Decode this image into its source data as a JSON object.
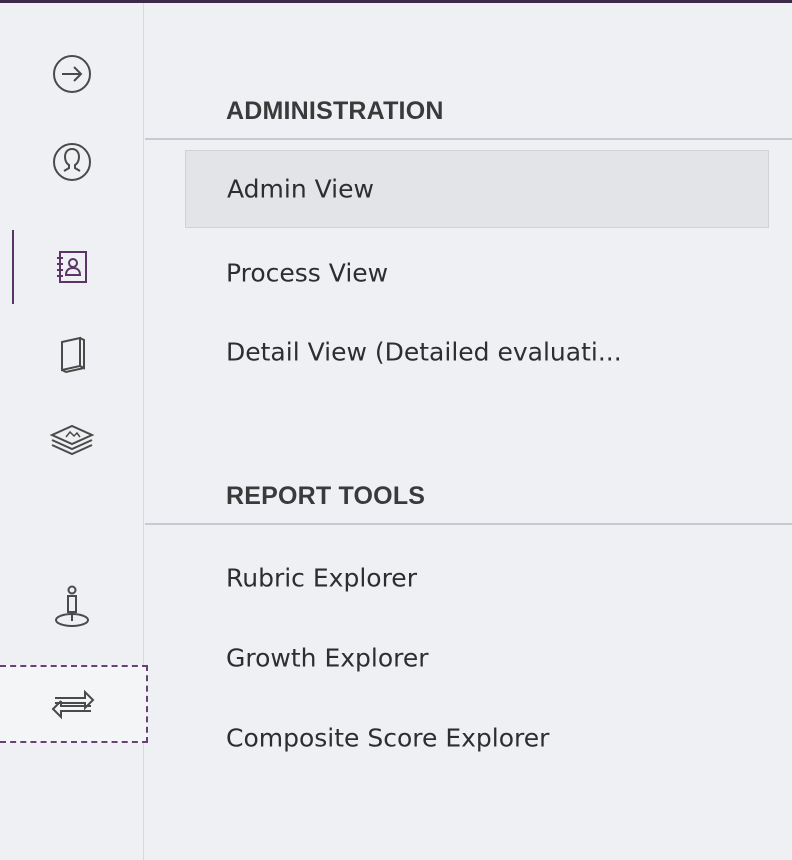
{
  "colors": {
    "accent": "#5b3566",
    "background": "#eef0f3",
    "selected_bg": "#e2e4e7",
    "text": "#2e2e2e"
  },
  "rail": {
    "icons": [
      {
        "name": "arrow-right-circle-icon",
        "active": false
      },
      {
        "name": "user-circle-icon",
        "active": false
      },
      {
        "name": "contacts-book-icon",
        "active": true
      },
      {
        "name": "book-icon",
        "active": false
      },
      {
        "name": "layers-icon",
        "active": false
      },
      {
        "name": "person-pin-icon",
        "active": false
      },
      {
        "name": "swap-arrows-icon",
        "active": false,
        "focused": true
      }
    ]
  },
  "panel": {
    "sections": [
      {
        "title": "ADMINISTRATION",
        "items": [
          {
            "label": "Admin View",
            "selected": true
          },
          {
            "label": "Process View",
            "selected": false
          },
          {
            "label": "Detail View (Detailed evaluati...",
            "selected": false
          }
        ]
      },
      {
        "title": "REPORT TOOLS",
        "items": [
          {
            "label": "Rubric Explorer",
            "selected": false
          },
          {
            "label": "Growth Explorer",
            "selected": false
          },
          {
            "label": "Composite Score Explorer",
            "selected": false
          }
        ]
      }
    ]
  }
}
